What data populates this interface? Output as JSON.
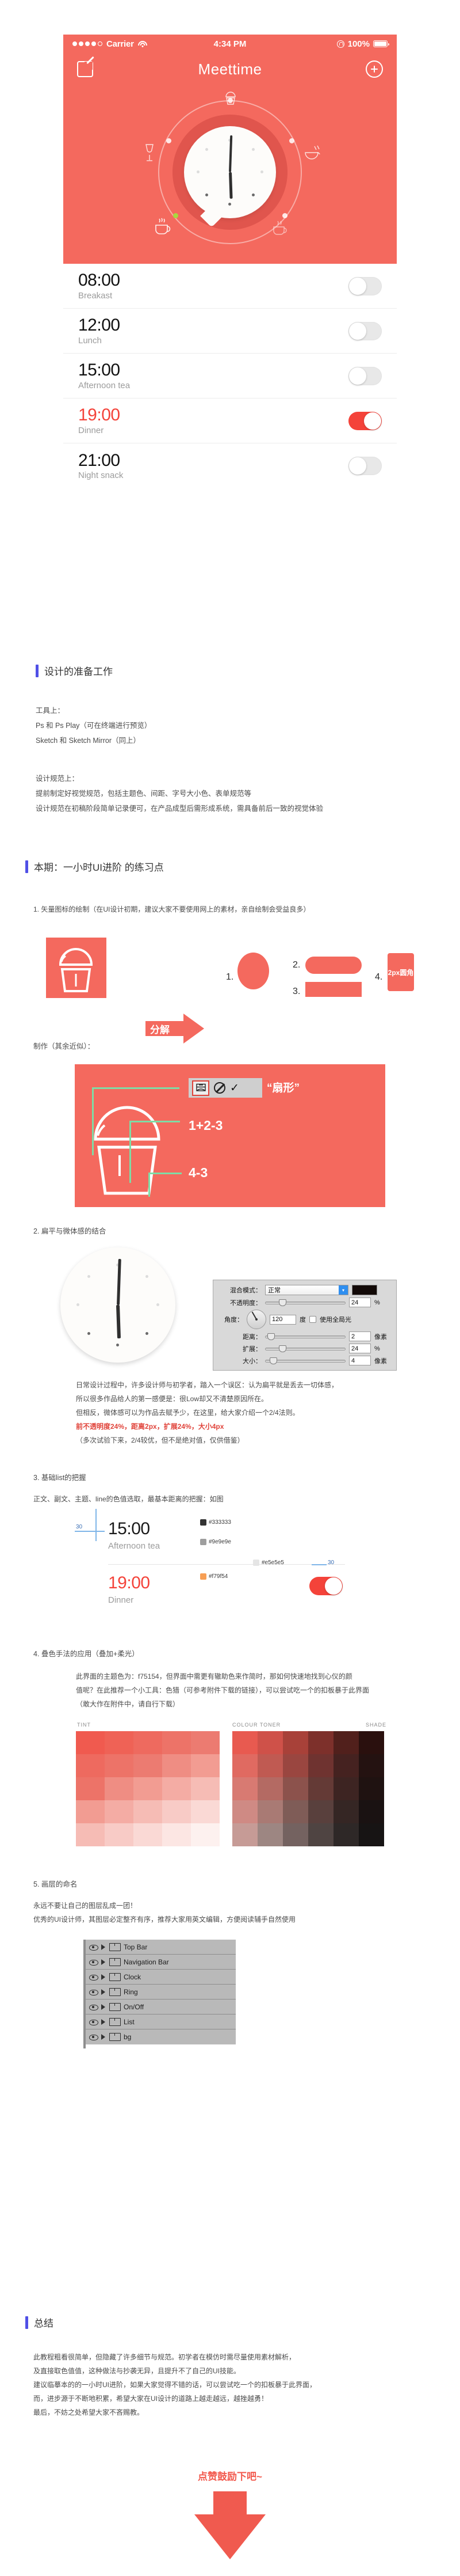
{
  "phone": {
    "status_bar": {
      "carrier": "Carrier",
      "time": "4:34 PM",
      "battery": "100%",
      "signal_dots": 5,
      "signal_filled": 4
    },
    "nav": {
      "title": "Meettime",
      "compose_icon": "compose-icon",
      "add_icon": "plus-icon"
    },
    "clock": {
      "hour_hand_deg": 178,
      "minute_hand_deg": 2,
      "display_time": "19:00"
    },
    "alarms": [
      {
        "time": "08:00",
        "label": "Breakast",
        "on": false
      },
      {
        "time": "12:00",
        "label": "Lunch",
        "on": false
      },
      {
        "time": "15:00",
        "label": "Afternoon tea",
        "on": false
      },
      {
        "time": "19:00",
        "label": "Dinner",
        "on": true
      },
      {
        "time": "21:00",
        "label": "Night snack",
        "on": false
      }
    ]
  },
  "prep": {
    "heading": "设计的准备工作",
    "tools_title": "工具上：",
    "tools_line1": "Ps 和 Ps Play（可在终端进行预览）",
    "tools_line2": "Sketch 和 Sketch Mirror（同上）",
    "spec_title": "设计规范上：",
    "spec_line1": "提前制定好视觉规范，包括主题色、间距、字号大小色、表单规范等",
    "spec_line2": "设计规范在初稿阶段简单记录便可，在产品成型后需形成系统，需具备前后一致的视觉体验"
  },
  "main": {
    "heading": "本期：一小时UI进阶 的练习点",
    "item1": {
      "title": "1. 矢量图标的绘制（在UI设计初期，建议大家不要使用网上的素材，亲自绘制会受益良多）",
      "decompose_label": "分解",
      "shape_nums": [
        "1.",
        "2.",
        "3.",
        "4."
      ],
      "shape4_text": "2px圆角",
      "make_title": "制作（其余近似）：",
      "warp_option": "“扇形”",
      "formula1": "1+2-3",
      "formula2": "4-3"
    },
    "item2": {
      "title": "2. 扁平与微体感的结合",
      "dialog": {
        "blend_label": "混合模式：",
        "blend_value": "正常",
        "opacity_label": "不透明度：",
        "opacity_value": "24",
        "opacity_unit": "%",
        "angle_label": "角度：",
        "angle_value": "120",
        "angle_unit": "度",
        "global_light": "使用全局光",
        "distance_label": "距离：",
        "distance_value": "2",
        "distance_unit": "像素",
        "spread_label": "扩展：",
        "spread_value": "24",
        "spread_unit": "%",
        "size_label": "大小：",
        "size_value": "4",
        "size_unit": "像素"
      },
      "p1": "日常设计过程中，许多设计师与初学者，踏入一个误区：认为扁平就是丢去一切体感，",
      "p2": "所以很多作品给人的第一感便是：很Low却又不清楚原因所在。",
      "p3": "但相反，微体感可以为作品去赋予少，在这里，给大家介绍一个2/4法则。",
      "p4_strong": "前不透明度24%，距离2px，扩展24%，大小4px",
      "p5": "（多次试验下来，2/4较优，但不是绝对值，仅供借鉴）"
    },
    "item3": {
      "title": "3. 基础list的把握",
      "desc": "正文、副文、主题、line的色值选取，最基本距离的把握：如图",
      "time1": "15:00",
      "label1": "Afternoon tea",
      "time2": "19:00",
      "label2": "Dinner",
      "dim_left": "30",
      "dim_right": "30",
      "sw1": "#333333",
      "sw2": "#9e9e9e",
      "sw3": "#e5e5e5",
      "sw4": "#f79f54"
    },
    "item4": {
      "title": "4. 叠色手法的应用（叠加+柔光）",
      "p1": "此界面的主题色为：f75154，但界面中需更有辙助色来作简时，那如何快速地找到心仪的颜",
      "p2": "值呢？在此推荐一个小工具：色猎（可参考附件下载的链接），可以尝试吃一个的扣板暴于此界面",
      "p3": "（敢大作在附件中，请自行下载）",
      "swatch_headers": [
        "TINT",
        "COLOUR TONER",
        "SHADE"
      ]
    },
    "item5": {
      "title": "5. 画层的命名",
      "p1": "永远不要让自己的图层乱成一团！",
      "p2": "优秀的UI设计师，其图层必定整齐有序，推荐大家用英文编辑，方便阅读辅手自然使用",
      "layers": [
        {
          "name": "Top Bar"
        },
        {
          "name": "Navigation Bar"
        },
        {
          "name": "Clock"
        },
        {
          "name": "Ring"
        },
        {
          "name": "On/Off"
        },
        {
          "name": "List"
        },
        {
          "name": "bg"
        }
      ]
    }
  },
  "summary": {
    "heading": "总结",
    "p1": "此教程粗看很简单，但隐藏了许多细节与规范。初学者在模仿时需尽量使用素材解析，",
    "p2": "及直接取色值值，这种做法与抄袭无异，且提升不了自己的UI技能。",
    "p3": "建议临摹本的的一小时UI进阶，如果大家觉得不错的话，可以尝试吃一个的扣板暴于此界面，",
    "p4": "而，进步源于不断地积累，希望大家在UI设计的道路上越走越远，越挫越勇！",
    "p5": "最后，不妨之处希望大家不吝赐教。"
  },
  "footer": {
    "cta": "点赞鼓励下吧~",
    "arrow_icon": "down-arrow-icon"
  },
  "colors": {
    "brand": "#f4695e",
    "brand_dark": "#e0554d",
    "accent_red": "#f4433a",
    "heading_bar": "#5050e6",
    "green_line": "#7fdca6",
    "panel_gray": "#b9b9b9"
  }
}
